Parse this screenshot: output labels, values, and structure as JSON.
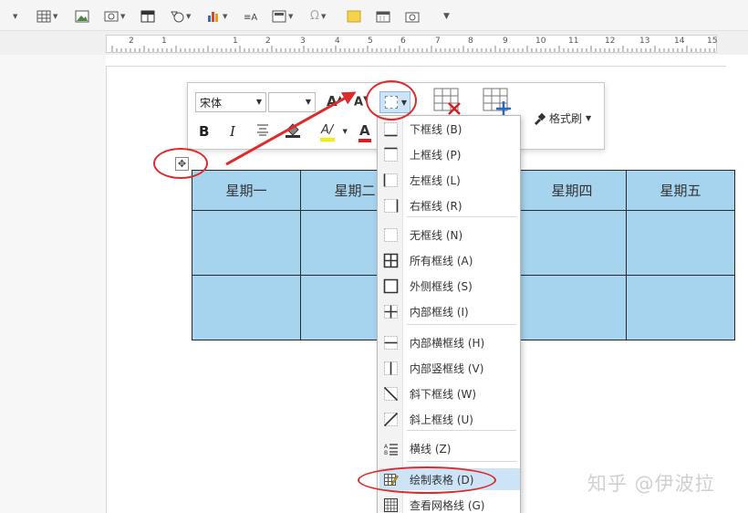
{
  "ribbon": {
    "icons": [
      "table-icon",
      "picture-icon",
      "screenshot-icon",
      "chart-grid-icon",
      "shapes-icon",
      "bar-chart-icon",
      "textbox-icon",
      "header-icon",
      "symbol-icon",
      "note-icon",
      "calendar-icon",
      "camera-icon"
    ],
    "symbol_label": "Ω"
  },
  "ruler": {
    "labels": [
      "2",
      "1",
      "1",
      "2",
      "3",
      "4",
      "5",
      "6",
      "7",
      "8",
      "9",
      "10",
      "11",
      "12",
      "13",
      "14",
      "15"
    ]
  },
  "mini_toolbar": {
    "font_name": "宋体",
    "font_size": "",
    "bold_label": "B",
    "italic_label": "I",
    "grow_font_label": "A",
    "shrink_font_label": "A",
    "highlight_label": "A",
    "font_color_label": "A",
    "format_painter_label": "格式刷"
  },
  "table": {
    "headers": [
      "星期一",
      "星期二",
      "",
      "星期四",
      "星期五"
    ]
  },
  "menu": {
    "items": [
      {
        "label": "下框线 (B)",
        "icon": "bottom-border-icon"
      },
      {
        "label": "上框线 (P)",
        "icon": "top-border-icon"
      },
      {
        "label": "左框线 (L)",
        "icon": "left-border-icon"
      },
      {
        "label": "右框线 (R)",
        "icon": "right-border-icon"
      },
      {
        "label": "无框线 (N)",
        "icon": "no-border-icon"
      },
      {
        "label": "所有框线 (A)",
        "icon": "all-borders-icon"
      },
      {
        "label": "外侧框线 (S)",
        "icon": "outside-borders-icon"
      },
      {
        "label": "内部框线 (I)",
        "icon": "inside-borders-icon"
      },
      {
        "label": "内部横框线 (H)",
        "icon": "inside-horizontal-border-icon"
      },
      {
        "label": "内部竖框线 (V)",
        "icon": "inside-vertical-border-icon"
      },
      {
        "label": "斜下框线 (W)",
        "icon": "diagonal-down-border-icon"
      },
      {
        "label": "斜上框线 (U)",
        "icon": "diagonal-up-border-icon"
      },
      {
        "label": "横线 (Z)",
        "icon": "horizontal-line-icon"
      },
      {
        "label": "绘制表格 (D)",
        "icon": "draw-table-icon"
      },
      {
        "label": "查看网格线 (G)",
        "icon": "view-gridlines-icon"
      }
    ]
  },
  "watermark": "知乎 @伊波拉",
  "colors": {
    "table_fill": "#a6d4ef",
    "annotation_red": "#e02a2a",
    "highlight_yellow": "#f4f000",
    "font_color_red": "#e01b1b",
    "menu_hover": "#cde4f7"
  }
}
